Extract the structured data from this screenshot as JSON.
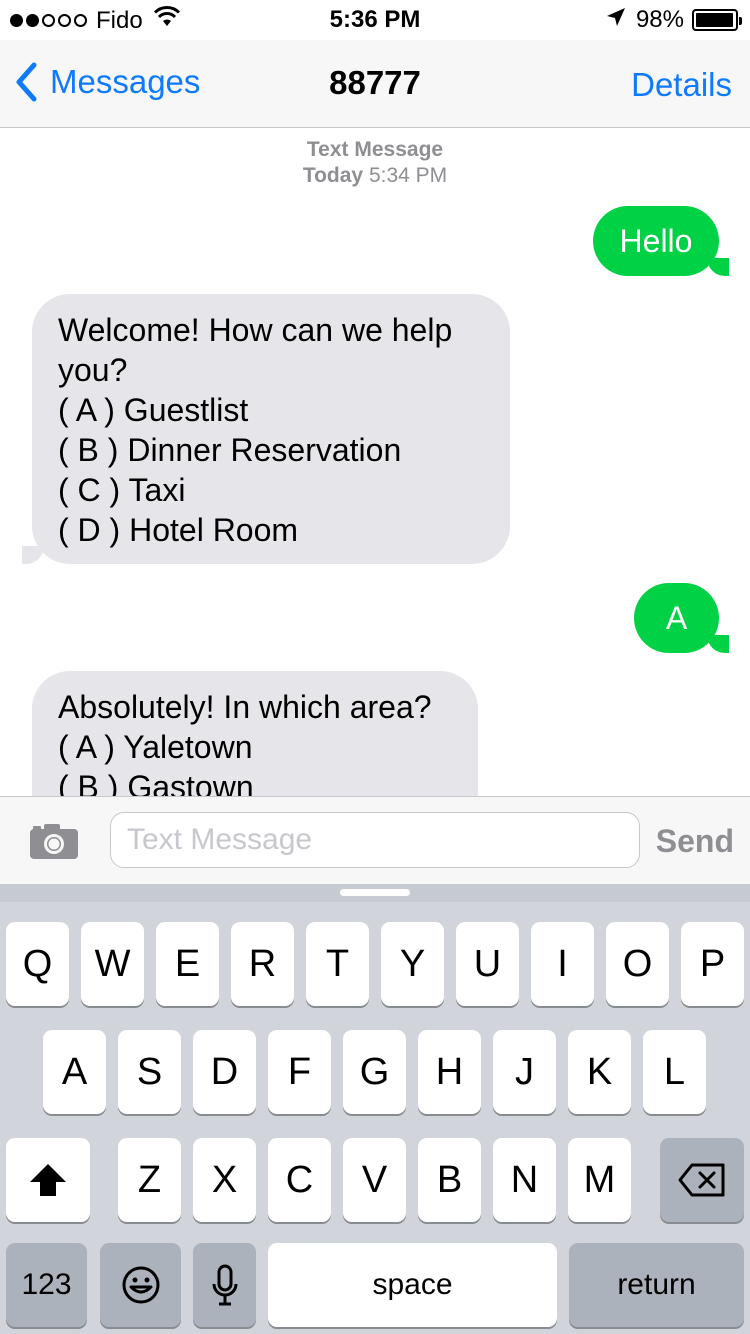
{
  "status_bar": {
    "carrier": "Fido",
    "time": "5:36 PM",
    "battery": "98%",
    "battery_level": 0.98,
    "signal_bars_filled": 2,
    "signal_bars_total": 5
  },
  "nav": {
    "back_label": "Messages",
    "title": "88777",
    "details_label": "Details"
  },
  "thread": {
    "meta_type": "Text Message",
    "meta_day": "Today",
    "meta_time": "5:34 PM"
  },
  "messages": [
    {
      "direction": "outgoing",
      "lines": [
        "Hello"
      ]
    },
    {
      "direction": "incoming",
      "lines": [
        "Welcome! How can we help",
        "you?",
        "( A ) Guestlist",
        "( B ) Dinner Reservation",
        "( C ) Taxi",
        "( D ) Hotel Room"
      ]
    },
    {
      "direction": "outgoing",
      "lines": [
        "A"
      ]
    },
    {
      "direction": "incoming",
      "lines": [
        "Absolutely! In which area?",
        "( A ) Yaletown",
        "( B ) Gastown"
      ]
    }
  ],
  "composer": {
    "placeholder": "Text Message",
    "send_label": "Send"
  },
  "keyboard": {
    "row1": [
      "Q",
      "W",
      "E",
      "R",
      "T",
      "Y",
      "U",
      "I",
      "O",
      "P"
    ],
    "row2": [
      "A",
      "S",
      "D",
      "F",
      "G",
      "H",
      "J",
      "K",
      "L"
    ],
    "row3": [
      "Z",
      "X",
      "C",
      "V",
      "B",
      "N",
      "M"
    ],
    "numbers_label": "123",
    "space_label": "space",
    "return_label": "return"
  },
  "colors": {
    "accent": "#0e7afe",
    "outgoing_bubble": "#00d145",
    "incoming_bubble": "#e5e5ea",
    "keyboard_bg": "#d1d5db"
  }
}
